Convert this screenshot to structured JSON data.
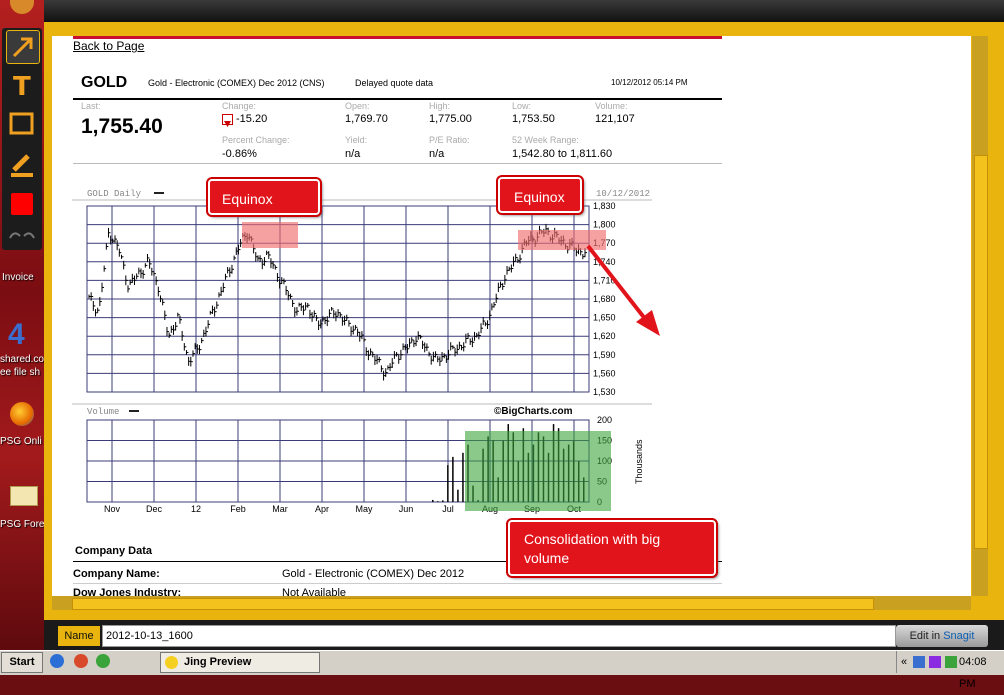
{
  "desktop": {
    "icons": [
      {
        "label": "Invoice"
      },
      {
        "label": "shared.co"
      },
      {
        "label": "ee file sh"
      },
      {
        "label": "PSG Onli"
      },
      {
        "label": "PSG Fore"
      }
    ]
  },
  "page": {
    "back_link": "Back to Page",
    "symbol": "GOLD",
    "description": "Gold - Electronic (COMEX) Dec 2012 (CNS)",
    "delayed": "Delayed quote data",
    "timestamp": "10/12/2012 05:14 PM",
    "last_label": "Last:",
    "last_value": "1,755.40",
    "change_label": "Change:",
    "change_value": "-15.20",
    "pct_change_label": "Percent Change:",
    "pct_change_value": "-0.86%",
    "open_label": "Open:",
    "open_value": "1,769.70",
    "yield_label": "Yield:",
    "yield_value": "n/a",
    "high_label": "High:",
    "high_value": "1,775.00",
    "pe_label": "P/E Ratio:",
    "pe_value": "n/a",
    "low_label": "Low:",
    "low_value": "1,753.50",
    "range_label": "52 Week Range:",
    "range_value": "1,542.80 to 1,811.60",
    "volume_label": "Volume:",
    "volume_value": "121,107",
    "company_data_heading": "Company Data",
    "company_name_label": "Company Name:",
    "company_name_value": "Gold - Electronic (COMEX) Dec 2012",
    "dow_jones_label": "Dow Jones Industry:",
    "dow_jones_value": "Not Available"
  },
  "chart_data": [
    {
      "type": "candlestick",
      "title": "GOLD Daily",
      "date_label": "10/12/2012",
      "x_ticks": [
        "Nov",
        "Dec",
        "12",
        "Feb",
        "Mar",
        "Apr",
        "May",
        "Jun",
        "Jul",
        "Aug",
        "Sep",
        "Oct"
      ],
      "y_ticks": [
        "1,830",
        "1,800",
        "1,770",
        "1,740",
        "1,710",
        "1,680",
        "1,650",
        "1,620",
        "1,590",
        "1,560",
        "1,530"
      ],
      "ylim": [
        1530,
        1830
      ],
      "approx_close": [
        1680,
        1660,
        1790,
        1760,
        1700,
        1720,
        1740,
        1700,
        1620,
        1650,
        1580,
        1600,
        1640,
        1680,
        1720,
        1760,
        1790,
        1740,
        1750,
        1720,
        1690,
        1660,
        1670,
        1640,
        1650,
        1660,
        1640,
        1630,
        1600,
        1580,
        1560,
        1590,
        1600,
        1620,
        1600,
        1580,
        1590,
        1600,
        1610,
        1620,
        1640,
        1680,
        1720,
        1740,
        1770,
        1780,
        1790,
        1780,
        1770,
        1760,
        1755
      ]
    },
    {
      "type": "bar",
      "title": "Volume",
      "ylabel": "Thousands",
      "y_ticks": [
        "200",
        "150",
        "100",
        "50",
        "0"
      ],
      "ylim": [
        0,
        200
      ],
      "watermark": "©BigCharts.com",
      "approx_values_aug_oct": [
        5,
        2,
        4,
        90,
        110,
        30,
        120,
        140,
        40,
        5,
        130,
        160,
        150,
        60,
        150,
        190,
        170,
        100,
        180,
        120,
        140,
        170,
        160,
        120,
        190,
        180,
        130,
        140,
        150,
        100,
        60
      ]
    }
  ],
  "annotations": {
    "equinox_left": "Equinox",
    "equinox_right": "Equinox",
    "consolidation": "Consolidation with big volume"
  },
  "jing": {
    "name_label": "Name",
    "name_value": "2012-10-13_1600",
    "edit_prefix": "Edit in",
    "edit_brand": "Snagit"
  },
  "taskbar": {
    "start": "Start",
    "task": "Jing Preview",
    "time": "04:08 PM",
    "tray_chevron": "«"
  },
  "colors": {
    "frame": "#e8b40d",
    "callout": "#e2141b",
    "highlight_red": "#f28b8b",
    "highlight_green": "#5fb55f",
    "grid": "#3b3b7a"
  }
}
